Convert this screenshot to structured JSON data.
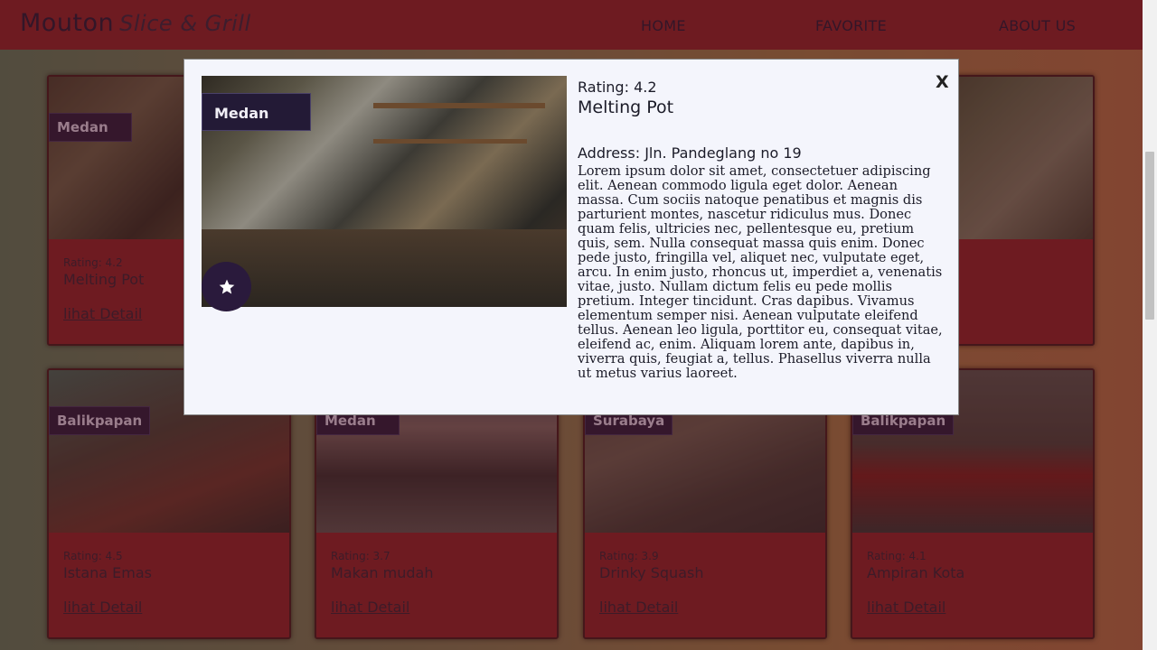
{
  "navbar": {
    "brand": "Mouton",
    "brand_sub": "Slice & Grill",
    "links": [
      "HOME",
      "FAVORITE",
      "ABOUT US"
    ]
  },
  "cards": [
    {
      "city": "Medan",
      "rating": "Rating: 4.2",
      "name": "Melting Pot",
      "detail": "lihat Detail"
    },
    {
      "city": "",
      "rating": "",
      "name": "",
      "detail": ""
    },
    {
      "city": "Balikpapan",
      "rating": "Rating: 4.5",
      "name": "Istana Emas",
      "detail": "lihat Detail"
    },
    {
      "city": "Medan",
      "rating": "Rating: 3.7",
      "name": "Makan mudah",
      "detail": "lihat Detail"
    },
    {
      "city": "Surabaya",
      "rating": "Rating: 3.9",
      "name": "Drinky Squash",
      "detail": "lihat Detail"
    },
    {
      "city": "Balikpapan",
      "rating": "Rating: 4.1",
      "name": "Ampiran Kota",
      "detail": "lihat Detail"
    }
  ],
  "modal": {
    "city": "Medan",
    "rating": "Rating: 4.2",
    "name": "Melting Pot",
    "address": "Address: Jln. Pandeglang no 19",
    "description": "Lorem ipsum dolor sit amet, consectetuer adipiscing elit. Aenean commodo ligula eget dolor. Aenean massa. Cum sociis natoque penatibus et magnis dis parturient montes, nascetur ridiculus mus. Donec quam felis, ultricies nec, pellentesque eu, pretium quis, sem. Nulla consequat massa quis enim. Donec pede justo, fringilla vel, aliquet nec, vulputate eget, arcu. In enim justo, rhoncus ut, imperdiet a, venenatis vitae, justo. Nullam dictum felis eu pede mollis pretium. Integer tincidunt. Cras dapibus. Vivamus elementum semper nisi. Aenean vulputate eleifend tellus. Aenean leo ligula, porttitor eu, consequat vitae, eleifend ac, enim. Aliquam lorem ante, dapibus in, viverra quis, feugiat a, tellus. Phasellus viverra nulla ut metus varius laoreet.",
    "close": "X",
    "favorite_icon": "star-icon"
  },
  "colors": {
    "navbar_bg": "#7a2026",
    "card_bg": "#7a2026",
    "badge_bg": "#231a36",
    "modal_bg": "#f4f5fc",
    "fav_button_bg": "#2a1a3c"
  }
}
